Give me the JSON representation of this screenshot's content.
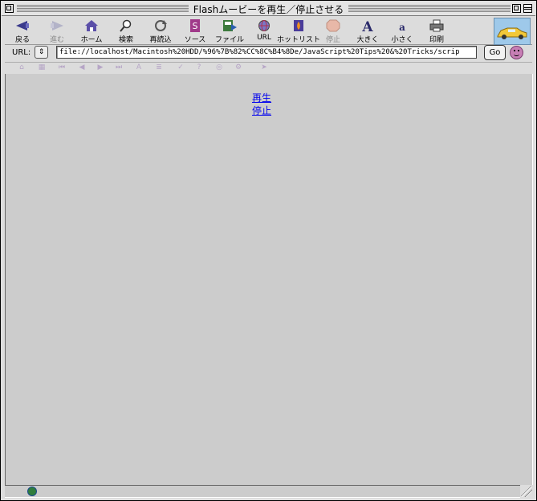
{
  "window": {
    "title": "Flashムービーを再生／停止させる"
  },
  "toolbar": {
    "buttons": [
      {
        "label": "戻る",
        "icon": "back-icon",
        "enabled": true
      },
      {
        "label": "進む",
        "icon": "forward-icon",
        "enabled": false
      },
      {
        "label": "ホーム",
        "icon": "home-icon",
        "enabled": true
      },
      {
        "label": "検索",
        "icon": "search-icon",
        "enabled": true
      },
      {
        "label": "再読込",
        "icon": "reload-icon",
        "enabled": true
      },
      {
        "label": "ソース",
        "icon": "source-icon",
        "enabled": true
      },
      {
        "label": "ファイル",
        "icon": "file-icon",
        "enabled": true
      },
      {
        "label": "URL",
        "icon": "url-icon",
        "enabled": true
      },
      {
        "label": "ホットリスト",
        "icon": "hotlist-icon",
        "enabled": true
      },
      {
        "label": "停止",
        "icon": "stop-icon",
        "enabled": false
      },
      {
        "label": "大きく",
        "icon": "larger-text-icon",
        "enabled": true
      },
      {
        "label": "小さく",
        "icon": "smaller-text-icon",
        "enabled": true
      },
      {
        "label": "印刷",
        "icon": "print-icon",
        "enabled": true
      }
    ]
  },
  "urlbar": {
    "label": "URL:",
    "value": "file://localhost/Macintosh%20HDD/%96%7B%82%CC%8C%B4%8De/JavaScript%20Tips%20&%20Tricks/scrip",
    "go_label": "Go"
  },
  "content": {
    "links": [
      "再生",
      "停止"
    ]
  },
  "colors": {
    "content_bg": "#cccccc",
    "link": "#0000ee"
  }
}
